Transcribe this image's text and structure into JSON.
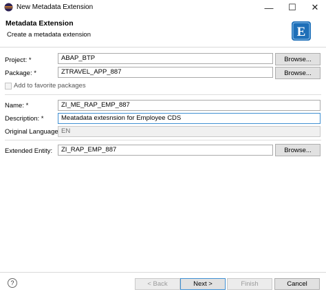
{
  "window": {
    "title": "New Metadata Extension",
    "minimize_glyph": "—",
    "maximize_glyph": "☐",
    "close_glyph": "✕",
    "app_icon": "eclipse-icon"
  },
  "header": {
    "title": "Metadata Extension",
    "subtitle": "Create a metadata extension",
    "logo_letter": "E",
    "logo_color": "#1e6fb8"
  },
  "form": {
    "project_label": "Project: *",
    "project_value": "ABAP_BTP",
    "package_label": "Package: *",
    "package_value": "ZTRAVEL_APP_887",
    "favorite_label": "Add to favorite packages",
    "name_label": "Name: *",
    "name_value": "ZI_ME_RAP_EMP_887",
    "description_label": "Description: *",
    "description_value": "Meatadata extesnsion for Employee CDS",
    "language_label": "Original Language:",
    "language_value": "EN",
    "extended_label": "Extended Entity:",
    "extended_value": "ZI_RAP_EMP_887",
    "browse_label": "Browse..."
  },
  "footer": {
    "help_glyph": "?",
    "back_label": "< Back",
    "next_label": "Next >",
    "finish_label": "Finish",
    "cancel_label": "Cancel"
  }
}
